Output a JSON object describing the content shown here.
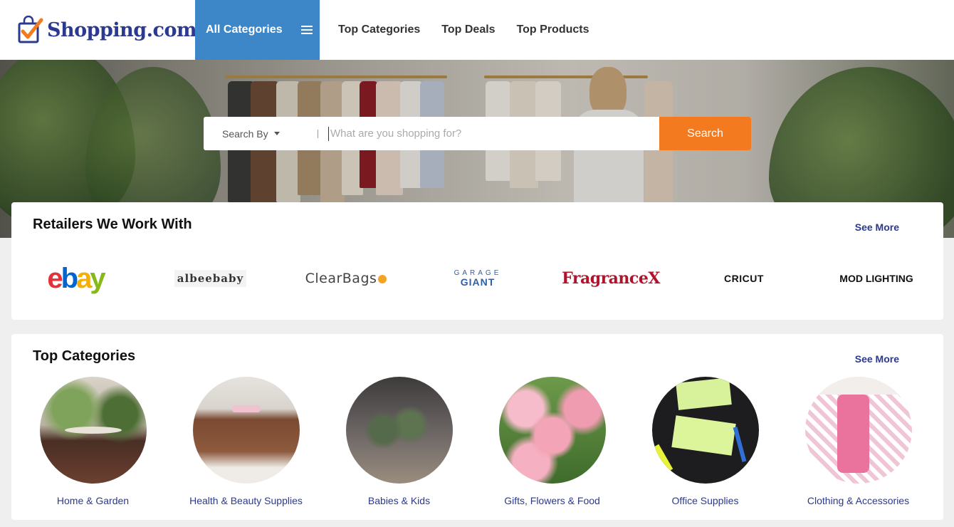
{
  "header": {
    "logo_text": "Shopping.com",
    "logo_reg": "®",
    "all_categories": "All Categories",
    "nav": [
      "Top Categories",
      "Top Deals",
      "Top Products"
    ]
  },
  "search": {
    "by_label": "Search By",
    "placeholder": "What are you shopping for?",
    "button": "Search"
  },
  "retailers": {
    "title": "Retailers We Work With",
    "see_more": "See More",
    "logos": {
      "ebay": [
        "e",
        "b",
        "a",
        "y"
      ],
      "albeebaby": "albeebaby",
      "clearbags": "ClearBags",
      "garage_top": "GARAGE",
      "garage_bottom": "GIANT",
      "fragrancex": "FragranceX",
      "cricut": "CRICUT",
      "mod_lighting": "MOD LIGHTING"
    }
  },
  "top_categories": {
    "title": "Top Categories",
    "see_more": "See More",
    "items": [
      {
        "label": "Home & Garden"
      },
      {
        "label": "Health & Beauty Supplies"
      },
      {
        "label": "Babies & Kids"
      },
      {
        "label": "Gifts, Flowers & Food"
      },
      {
        "label": "Office Supplies"
      },
      {
        "label": "Clothing & Accessories"
      }
    ]
  },
  "colors": {
    "brand_blue": "#2b3990",
    "all_categories_bg": "#3d87c9",
    "search_button": "#f47a1f"
  }
}
